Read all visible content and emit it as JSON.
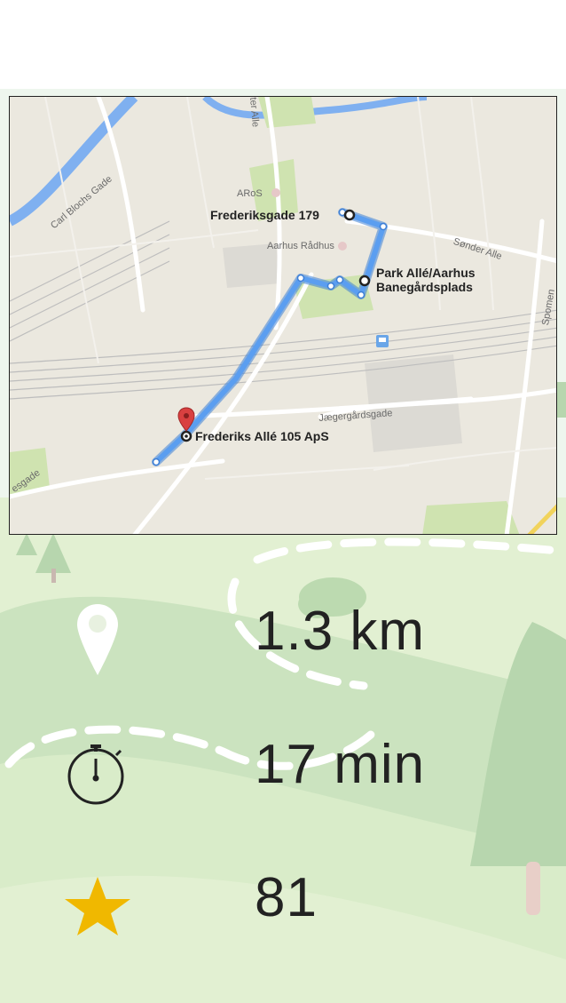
{
  "map": {
    "labels": {
      "frederiksgade": "Frederiksgade 179",
      "park_alle_line1": "Park Allé/Aarhus",
      "park_alle_line2": "Banegårdsplads",
      "frederiks_alle": "Frederiks Allé 105 ApS"
    },
    "streets": {
      "aros": "ARoS",
      "aarhus_radhus": "Aarhus Rådhus",
      "sonder_alle": "Sønder Alle",
      "carl_blocha": "Carl Blochs Gade",
      "jaegergard": "Jægergårdsgade",
      "spomen": "Spomen",
      "alle_top": "ter Alle",
      "sgade": "esgade"
    }
  },
  "stats": {
    "distance": {
      "value": "1.3 km",
      "icon": "location-pin-icon"
    },
    "duration": {
      "value": "17 min",
      "icon": "stopwatch-icon"
    },
    "points": {
      "value": "81",
      "icon": "star-icon"
    }
  },
  "colors": {
    "route": "#4a90e2",
    "pin": "#d94040",
    "star": "#f0b800",
    "grass_light": "#e2f0d2",
    "grass_mid": "#cbe3bf",
    "tree": "#b7d6ae"
  }
}
